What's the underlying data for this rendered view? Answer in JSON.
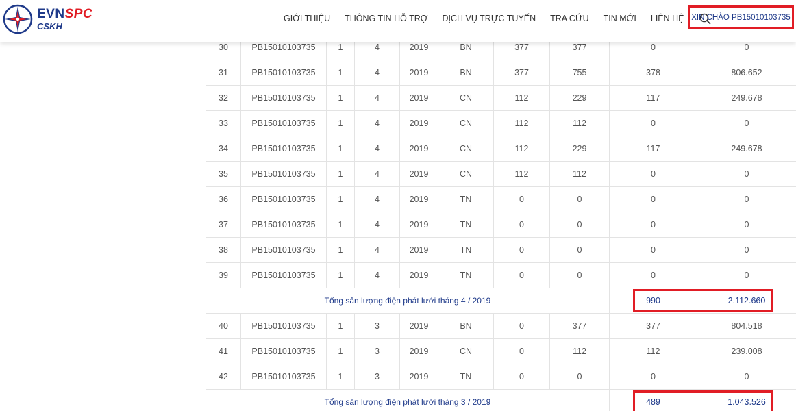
{
  "brand": {
    "part1": "EVN",
    "part2": "SPC",
    "sub": "CSKH",
    "colors": {
      "blue": "#1f3a8a",
      "red": "#e11d25"
    }
  },
  "nav": {
    "items": [
      "GIỚI THIỆU",
      "THÔNG TIN HỖ TRỢ",
      "DỊCH VỤ TRỰC TUYẾN",
      "TRA CỨU",
      "TIN MỚI",
      "LIÊN HỆ"
    ],
    "search_icon": "search-icon",
    "user_greeting": "XIN CHÀO PB15010103735"
  },
  "table": {
    "rows": [
      {
        "stt": "30",
        "ma": "PB15010103735",
        "c1": "1",
        "thang": "4",
        "nam": "2019",
        "bo_so": "BN",
        "chi_so_cu": "377",
        "chi_so_moi": "377",
        "san_luong": "0",
        "thanh_tien": "0"
      },
      {
        "stt": "31",
        "ma": "PB15010103735",
        "c1": "1",
        "thang": "4",
        "nam": "2019",
        "bo_so": "BN",
        "chi_so_cu": "377",
        "chi_so_moi": "755",
        "san_luong": "378",
        "thanh_tien": "806.652"
      },
      {
        "stt": "32",
        "ma": "PB15010103735",
        "c1": "1",
        "thang": "4",
        "nam": "2019",
        "bo_so": "CN",
        "chi_so_cu": "112",
        "chi_so_moi": "229",
        "san_luong": "117",
        "thanh_tien": "249.678"
      },
      {
        "stt": "33",
        "ma": "PB15010103735",
        "c1": "1",
        "thang": "4",
        "nam": "2019",
        "bo_so": "CN",
        "chi_so_cu": "112",
        "chi_so_moi": "112",
        "san_luong": "0",
        "thanh_tien": "0"
      },
      {
        "stt": "34",
        "ma": "PB15010103735",
        "c1": "1",
        "thang": "4",
        "nam": "2019",
        "bo_so": "CN",
        "chi_so_cu": "112",
        "chi_so_moi": "229",
        "san_luong": "117",
        "thanh_tien": "249.678"
      },
      {
        "stt": "35",
        "ma": "PB15010103735",
        "c1": "1",
        "thang": "4",
        "nam": "2019",
        "bo_so": "CN",
        "chi_so_cu": "112",
        "chi_so_moi": "112",
        "san_luong": "0",
        "thanh_tien": "0"
      },
      {
        "stt": "36",
        "ma": "PB15010103735",
        "c1": "1",
        "thang": "4",
        "nam": "2019",
        "bo_so": "TN",
        "chi_so_cu": "0",
        "chi_so_moi": "0",
        "san_luong": "0",
        "thanh_tien": "0"
      },
      {
        "stt": "37",
        "ma": "PB15010103735",
        "c1": "1",
        "thang": "4",
        "nam": "2019",
        "bo_so": "TN",
        "chi_so_cu": "0",
        "chi_so_moi": "0",
        "san_luong": "0",
        "thanh_tien": "0"
      },
      {
        "stt": "38",
        "ma": "PB15010103735",
        "c1": "1",
        "thang": "4",
        "nam": "2019",
        "bo_so": "TN",
        "chi_so_cu": "0",
        "chi_so_moi": "0",
        "san_luong": "0",
        "thanh_tien": "0"
      },
      {
        "stt": "39",
        "ma": "PB15010103735",
        "c1": "1",
        "thang": "4",
        "nam": "2019",
        "bo_so": "TN",
        "chi_so_cu": "0",
        "chi_so_moi": "0",
        "san_luong": "0",
        "thanh_tien": "0"
      },
      {
        "total": true,
        "label": "Tổng sản lượng điện phát lưới tháng 4 / 2019",
        "san_luong": "990",
        "thanh_tien": "2.112.660",
        "highlighted": true
      },
      {
        "stt": "40",
        "ma": "PB15010103735",
        "c1": "1",
        "thang": "3",
        "nam": "2019",
        "bo_so": "BN",
        "chi_so_cu": "0",
        "chi_so_moi": "377",
        "san_luong": "377",
        "thanh_tien": "804.518"
      },
      {
        "stt": "41",
        "ma": "PB15010103735",
        "c1": "1",
        "thang": "3",
        "nam": "2019",
        "bo_so": "CN",
        "chi_so_cu": "0",
        "chi_so_moi": "112",
        "san_luong": "112",
        "thanh_tien": "239.008"
      },
      {
        "stt": "42",
        "ma": "PB15010103735",
        "c1": "1",
        "thang": "3",
        "nam": "2019",
        "bo_so": "TN",
        "chi_so_cu": "0",
        "chi_so_moi": "0",
        "san_luong": "0",
        "thanh_tien": "0"
      },
      {
        "total": true,
        "label": "Tổng sản lượng điện phát lưới tháng 3 / 2019",
        "san_luong": "489",
        "thanh_tien": "1.043.526",
        "highlighted": true
      }
    ]
  }
}
